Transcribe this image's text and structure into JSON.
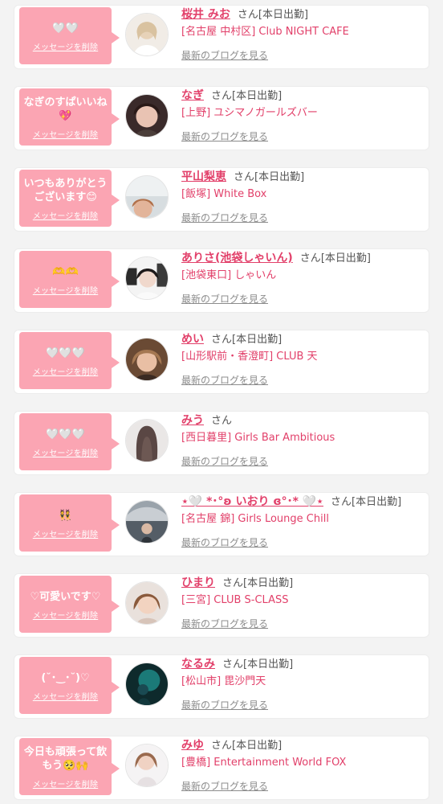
{
  "favorites": [
    {
      "message": "🤍🤍",
      "delete_label": "メッセージを削除",
      "name": "桜井 みお",
      "suffix": "さん",
      "status": "[本日出勤]",
      "shop": "[名古屋 中村区] Club NIGHT CAFE",
      "blog_link": "最新のブログを見る"
    },
    {
      "message": "なぎのすぱいいね\n💖",
      "delete_label": "メッセージを削除",
      "name": "なぎ",
      "suffix": "さん",
      "status": "[本日出勤]",
      "shop": "[上野] ユシマノガールズバー",
      "blog_link": "最新のブログを見る"
    },
    {
      "message": "いつもありがとう\nございます😊",
      "delete_label": "メッセージを削除",
      "name": "平山梨恵",
      "suffix": "さん",
      "status": "[本日出勤]",
      "shop": "[飯塚] White Box",
      "blog_link": "最新のブログを見る"
    },
    {
      "message": "🫶🫶",
      "delete_label": "メッセージを削除",
      "name": "ありさ(池袋しゃいん)",
      "suffix": "さん",
      "status": "[本日出勤]",
      "shop": "[池袋東口] しゃいん",
      "blog_link": "最新のブログを見る"
    },
    {
      "message": "🤍🤍🤍",
      "delete_label": "メッセージを削除",
      "name": "めい",
      "suffix": "さん",
      "status": "[本日出勤]",
      "shop": "[山形駅前・香澄町] CLUB 天",
      "blog_link": "最新のブログを見る"
    },
    {
      "message": "🤍🤍🤍",
      "delete_label": "メッセージを削除",
      "name": "みう",
      "suffix": "さん",
      "status": "",
      "shop": "[西日暮里] Girls Bar Ambitious",
      "blog_link": "最新のブログを見る"
    },
    {
      "message": "👯",
      "delete_label": "メッセージを削除",
      "name": "⋆🤍 *･°ʚ いおり ɞ°･* 🤍⋆",
      "suffix": "さん",
      "status": "[本日出勤]",
      "shop": "[名古屋 錦] Girls Lounge Chill",
      "blog_link": "最新のブログを見る"
    },
    {
      "message": "♡可愛いです♡",
      "delete_label": "メッセージを削除",
      "name": "ひまり",
      "suffix": "さん",
      "status": "[本日出勤]",
      "shop": "[三宮] CLUB S-CLASS",
      "blog_link": "最新のブログを見る"
    },
    {
      "message": "(˘･‿･˘)♡",
      "delete_label": "メッセージを削除",
      "name": "なるみ",
      "suffix": "さん",
      "status": "[本日出勤]",
      "shop": "[松山市] 毘沙門天",
      "blog_link": "最新のブログを見る"
    },
    {
      "message": "今日も頑張って飲\nもう🥺🙌",
      "delete_label": "メッセージを削除",
      "name": "みゆ",
      "suffix": "さん",
      "status": "[本日出勤]",
      "shop": "[豊橋] Entertainment World FOX",
      "blog_link": "最新のブログを見る"
    }
  ],
  "colors": {
    "accent": "#e2406a",
    "bubble": "#fba5b3",
    "muted": "#8c8c8c",
    "background": "#f3f3f3"
  }
}
